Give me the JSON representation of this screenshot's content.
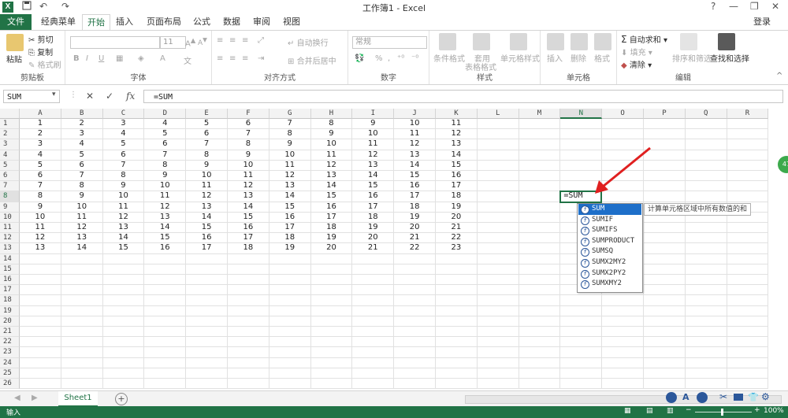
{
  "window": {
    "title": "工作簿1 - Excel",
    "help": "?",
    "minimize": "—",
    "restore": "❐",
    "close": "✕"
  },
  "quick_access": {
    "save": "💾",
    "undo": "↶",
    "redo": "↷"
  },
  "tabs": {
    "file": "文件",
    "items": [
      "经典菜单",
      "开始",
      "插入",
      "页面布局",
      "公式",
      "数据",
      "审阅",
      "视图"
    ],
    "active_index": 1
  },
  "login": "登录",
  "ribbon": {
    "clipboard": {
      "label": "剪贴板",
      "paste": "粘贴",
      "cut": "剪切",
      "copy": "复制",
      "format_painter": "格式刷"
    },
    "font": {
      "label": "字体",
      "size": "11",
      "bold": "B",
      "italic": "I",
      "underline": "U"
    },
    "alignment": {
      "label": "对齐方式",
      "wrap": "自动换行",
      "merge": "合并后居中"
    },
    "number": {
      "label": "数字",
      "format": "常规",
      "percent": "%",
      "comma": ","
    },
    "styles": {
      "label": "样式",
      "conditional": "条件格式",
      "as_table_1": "套用",
      "as_table_2": "表格格式",
      "cell_styles": "单元格样式"
    },
    "cells": {
      "label": "单元格",
      "insert": "插入",
      "delete": "删除",
      "format": "格式"
    },
    "editing": {
      "label": "编辑",
      "autosum": "自动求和",
      "fill": "填充",
      "clear": "清除",
      "sort": "排序和筛选",
      "find": "查找和选择"
    }
  },
  "formula_bar": {
    "name_box": "SUM",
    "cancel": "✕",
    "enter": "✓",
    "fx": "fx",
    "content": "=SUM"
  },
  "sheet": {
    "columns": [
      "A",
      "B",
      "C",
      "D",
      "E",
      "F",
      "G",
      "H",
      "I",
      "J",
      "K",
      "L",
      "M",
      "N",
      "O",
      "P",
      "Q",
      "R"
    ],
    "selected_column": "N",
    "selected_row": 8,
    "row_count": 26,
    "data": [
      [
        1,
        2,
        3,
        4,
        5,
        6,
        7,
        8,
        9,
        10,
        11
      ],
      [
        2,
        3,
        4,
        5,
        6,
        7,
        8,
        9,
        10,
        11,
        12
      ],
      [
        3,
        4,
        5,
        6,
        7,
        8,
        9,
        10,
        11,
        12,
        13
      ],
      [
        4,
        5,
        6,
        7,
        8,
        9,
        10,
        11,
        12,
        13,
        14
      ],
      [
        5,
        6,
        7,
        8,
        9,
        10,
        11,
        12,
        13,
        14,
        15
      ],
      [
        6,
        7,
        8,
        9,
        10,
        11,
        12,
        13,
        14,
        15,
        16
      ],
      [
        7,
        8,
        9,
        10,
        11,
        12,
        13,
        14,
        15,
        16,
        17
      ],
      [
        8,
        9,
        10,
        11,
        12,
        13,
        14,
        15,
        16,
        17,
        18
      ],
      [
        9,
        10,
        11,
        12,
        13,
        14,
        15,
        16,
        17,
        18,
        19
      ],
      [
        10,
        11,
        12,
        13,
        14,
        15,
        16,
        17,
        18,
        19,
        20
      ],
      [
        11,
        12,
        13,
        14,
        15,
        16,
        17,
        18,
        19,
        20,
        21
      ],
      [
        12,
        13,
        14,
        15,
        16,
        17,
        18,
        19,
        20,
        21,
        22
      ],
      [
        13,
        14,
        15,
        16,
        17,
        18,
        19,
        20,
        21,
        22,
        23
      ]
    ],
    "active_cell_text": "=SUM"
  },
  "autocomplete": {
    "items": [
      "SUM",
      "SUMIF",
      "SUMIFS",
      "SUMPRODUCT",
      "SUMSQ",
      "SUMX2MY2",
      "SUMX2PY2",
      "SUMXMY2"
    ],
    "selected_index": 0,
    "tooltip": "计算单元格区域中所有数值的和"
  },
  "sheet_tabs": {
    "active": "Sheet1",
    "add": "+"
  },
  "status": {
    "mode": "输入",
    "zoom": "100%"
  },
  "side_bubble": "47",
  "colors": {
    "excel_green": "#217346",
    "selection_blue": "#1e6fc9",
    "arrow_red": "#e02020"
  }
}
